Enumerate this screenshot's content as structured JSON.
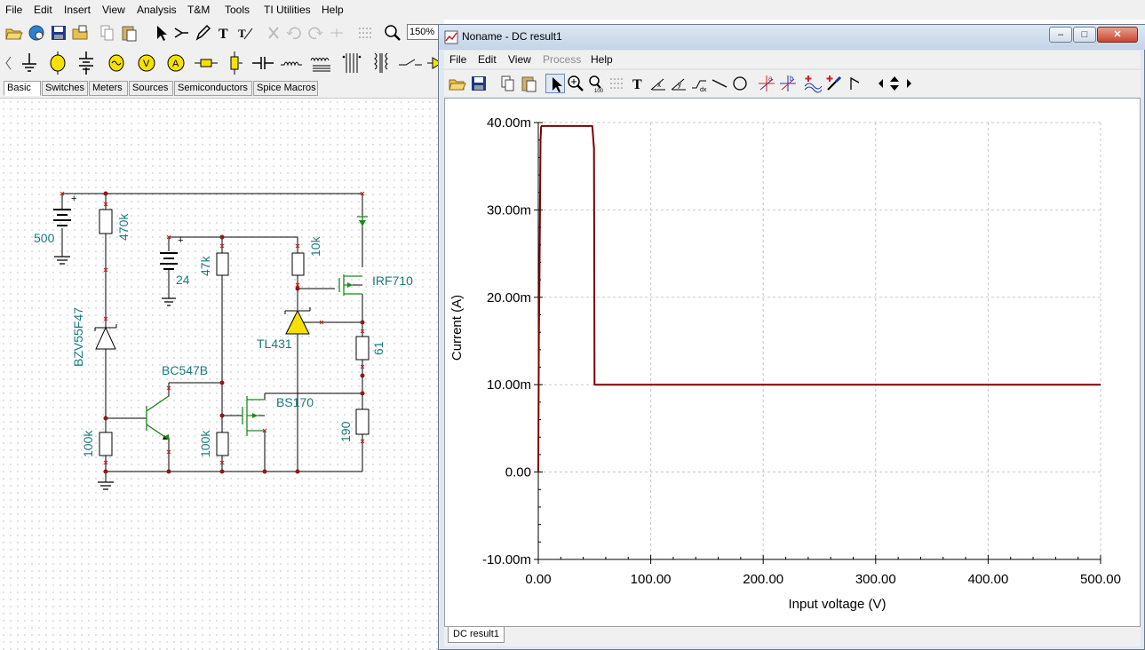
{
  "app": {
    "menu": [
      "File",
      "Edit",
      "Insert",
      "View",
      "Analysis",
      "T&M",
      "Tools",
      "TI Utilities",
      "Help"
    ],
    "zoom": "150%",
    "category_tabs": [
      "Basic",
      "Switches",
      "Meters",
      "Sources",
      "Semiconductors",
      "Spice Macros"
    ],
    "active_tab": "Basic"
  },
  "schematic": {
    "labels": {
      "v500": "500",
      "v24": "24",
      "r470k": "470k",
      "r47k": "47k",
      "r10k": "10k",
      "zener": "BZV55F47",
      "q1": "BC547B",
      "r100k_left": "100k",
      "r100k_mid": "100k",
      "tl431": "TL431",
      "bs170": "BS170",
      "irf710": "IRF710",
      "r61": "61",
      "r190": "190",
      "plus_a": "+",
      "plus_b": "+"
    }
  },
  "dc_window": {
    "title": "Noname - DC result1",
    "menu": [
      "File",
      "Edit",
      "View",
      "Process",
      "Help"
    ],
    "disabled_menu": "Process",
    "tab": "DC result1",
    "win_buttons": {
      "minimize": "–",
      "maximize": "□",
      "close": "✕"
    }
  },
  "chart_data": {
    "type": "line",
    "xlabel": "Input voltage (V)",
    "ylabel": "Current (A)",
    "xlim": [
      0,
      500
    ],
    "ylim": [
      -10,
      40
    ],
    "xticks": [
      "0.00",
      "100.00",
      "200.00",
      "300.00",
      "400.00",
      "500.00"
    ],
    "yticks": [
      "-10.00m",
      "0.00",
      "10.00m",
      "20.00m",
      "30.00m",
      "40.00m"
    ],
    "grid": true,
    "series": [
      {
        "color": "#7b0000",
        "x": [
          0,
          0.5,
          1,
          1.5,
          2,
          2.5,
          3,
          10,
          20,
          30,
          40,
          48,
          49,
          49.5,
          50,
          100,
          200,
          300,
          400,
          500
        ],
        "y": [
          0,
          15,
          22,
          30,
          38,
          39.5,
          39.6,
          39.6,
          39.6,
          39.6,
          39.6,
          39.6,
          38,
          37,
          10,
          10,
          10,
          10,
          10,
          10
        ]
      }
    ]
  }
}
